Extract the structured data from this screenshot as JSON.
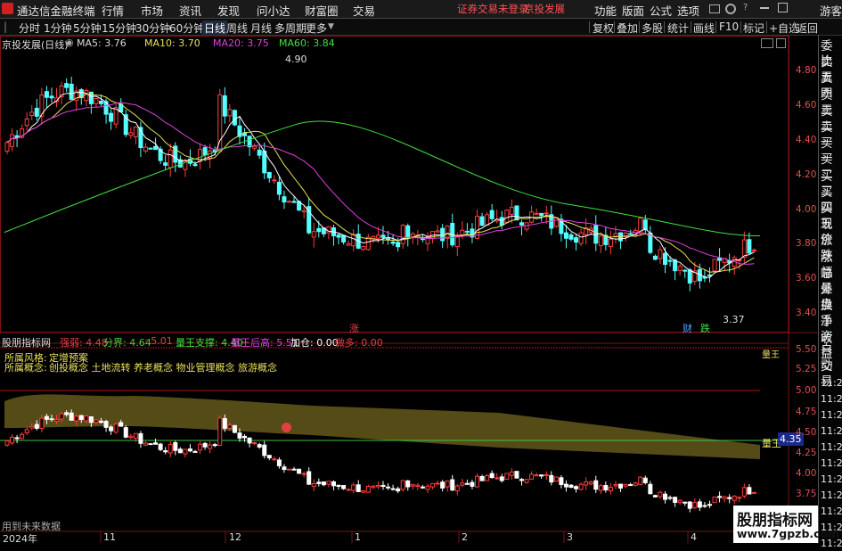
{
  "app": {
    "name": "通达信金融终端",
    "menus": [
      "行情",
      "市场",
      "资讯",
      "发现",
      "问小达",
      "财富圈",
      "交易"
    ],
    "status_login": "证券交易未登录",
    "stock_name": "京投发展",
    "right_menus": [
      "功能",
      "版面",
      "公式",
      "选项"
    ],
    "guest": "游客"
  },
  "periods": [
    "分时",
    "1分钟",
    "5分钟",
    "15分钟",
    "30分钟",
    "60分钟",
    "日线",
    "周线",
    "月线",
    "多周期",
    "更多"
  ],
  "active_period": "日线",
  "toolbar": [
    "复权",
    "叠加",
    "多股",
    "统计",
    "画线",
    "F10",
    "标记",
    "+自选",
    "返回"
  ],
  "main_chart": {
    "header_name": "京投发展(日线)",
    "ma": [
      {
        "label": "MA5: 3.76",
        "color": "#ffffff"
      },
      {
        "label": "MA10: 3.70",
        "color": "#e8e05a"
      },
      {
        "label": "MA20: 3.75",
        "color": "#e040e0"
      },
      {
        "label": "MA60: 3.84",
        "color": "#40e040"
      }
    ],
    "y_ticks": [
      "4.80",
      "4.60",
      "4.40",
      "4.20",
      "4.00",
      "3.80",
      "3.60",
      "3.40"
    ],
    "high_label": "4.90",
    "low_label": "3.37",
    "marker_zhang": "涨",
    "marker_cai": "财",
    "marker_die": "跌"
  },
  "indicator": {
    "name": "股朋指标网",
    "values": [
      {
        "label": "强弱: 4.48",
        "color": "#e04040"
      },
      {
        "label": "分界: 4.64",
        "color": "#40d040"
      },
      {
        "label": ": 5.01",
        "color": "#e04040"
      },
      {
        "label": "量王支撑: 4.40",
        "color": "#40e040"
      },
      {
        "label": "量王后高: 5.51",
        "color": "#e040e0"
      },
      {
        "label": "加仓: 0.00",
        "color": "#ffffff"
      },
      {
        "label": "做多: 0.00",
        "color": "#e04040"
      }
    ],
    "style_label": "所属风格:",
    "style_value": "定增预案",
    "concept_label": "所属概念:",
    "concept_value": "创投概念 土地流转 养老概念 物业管理概念 旅游概念",
    "y_ticks": [
      "5.50",
      "5.25",
      "5.00",
      "4.75",
      "4.50",
      "4.25",
      "4.00",
      "3.75"
    ],
    "support_label": "量王",
    "support_value": "4.35",
    "top_label": "量王"
  },
  "footer": {
    "info": "用到未来数据",
    "x_labels": [
      "2024年",
      "11",
      "12",
      "1",
      "2",
      "3",
      "4"
    ]
  },
  "right_panel": [
    "委比",
    "卖五",
    "卖四",
    "卖三",
    "卖二",
    "卖一",
    "买一",
    "买二",
    "买三",
    "买四",
    "买五",
    "现价",
    "涨跌",
    "涨幅",
    "总量",
    "外盘",
    "换手",
    "净资",
    "收益"
  ],
  "right_panel_bottom": [
    "自动",
    "交易",
    "11:29",
    "11:29",
    "11:29",
    "11:29",
    "11:29",
    "11:29",
    "11:29",
    "11:29",
    "11:29",
    "11:29",
    "11:29"
  ],
  "watermark": {
    "line1": "股朋指标网",
    "line2": "www.7gpzb.com"
  }
}
